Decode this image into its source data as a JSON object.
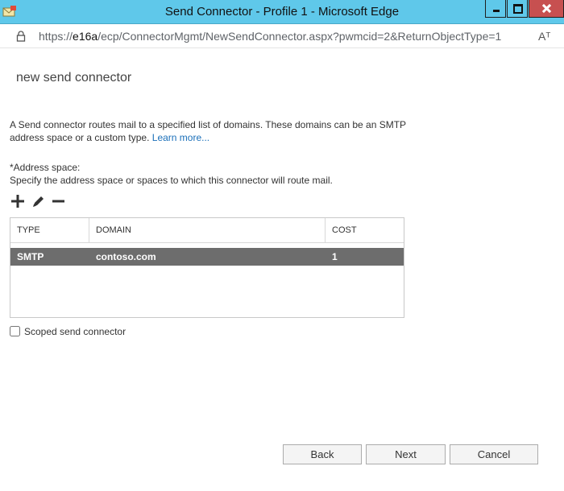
{
  "window": {
    "title": "Send Connector - Profile 1 - Microsoft Edge"
  },
  "address_bar": {
    "url_prefix": "https://",
    "url_host": "e16a",
    "url_path": "/ecp/ConnectorMgmt/NewSendConnector.aspx?pwmcid=2&ReturnObjectType=1",
    "read_aloud": "Aᵀ"
  },
  "page": {
    "title": "new send connector",
    "description": "A Send connector routes mail to a specified list of domains. These domains can be an SMTP address space or a custom type.",
    "learn_more": "Learn more..."
  },
  "address_space": {
    "label": "*Address space:",
    "help": "Specify the address space or spaces to which this connector will route mail.",
    "toolbar": {
      "add_icon": "plus-icon",
      "edit_icon": "pencil-icon",
      "remove_icon": "minus-icon"
    },
    "columns": [
      "TYPE",
      "DOMAIN",
      "COST"
    ],
    "rows": [
      {
        "type": "SMTP",
        "domain": "contoso.com",
        "cost": "1",
        "selected": true
      }
    ],
    "selected_row_color": "#6d6d6d"
  },
  "scoped": {
    "label": "Scoped send connector",
    "checked": false
  },
  "buttons": {
    "back": "Back",
    "next": "Next",
    "cancel": "Cancel"
  },
  "colors": {
    "titlebar": "#5fc8ea",
    "close_button": "#c75050",
    "link": "#1a6fb9"
  }
}
